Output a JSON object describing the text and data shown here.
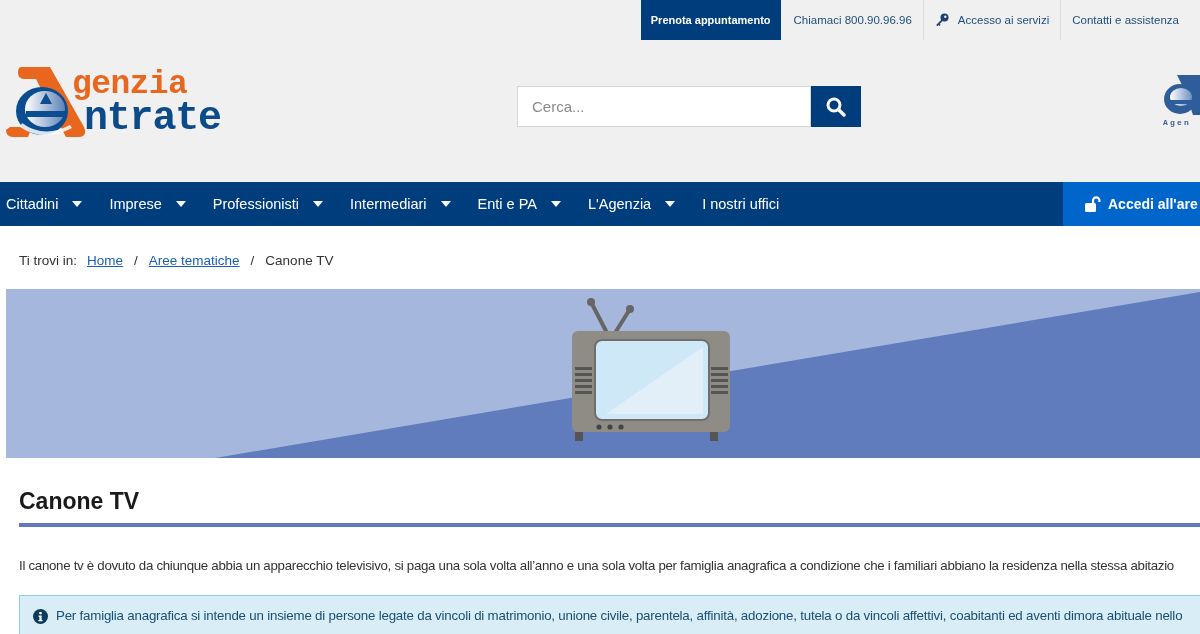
{
  "top_bar": {
    "appointment_button": "Prenota appuntamento",
    "links": [
      {
        "kind": "text",
        "label": "Chiamaci 800.90.96.96"
      },
      {
        "kind": "key",
        "label": "Accesso ai servizi"
      },
      {
        "kind": "text",
        "label": "Contatti e assistenza"
      }
    ]
  },
  "header": {
    "logo": {
      "line_1": "genzia",
      "line_2": "ntrate"
    },
    "search": {
      "placeholder": "Cerca..."
    },
    "emblem_caption": "Agen"
  },
  "nav": {
    "items": [
      {
        "label": "Cittadini",
        "has_menu": true
      },
      {
        "label": "Imprese",
        "has_menu": true
      },
      {
        "label": "Professionisti",
        "has_menu": true
      },
      {
        "label": "Intermediari",
        "has_menu": true
      },
      {
        "label": "Enti e PA",
        "has_menu": true
      },
      {
        "label": "L'Agenzia",
        "has_menu": true
      },
      {
        "label": "I nostri uffici",
        "has_menu": false
      }
    ],
    "login_button": "Accedi all'are"
  },
  "breadcrumb": [
    {
      "kind": "label",
      "text": "Ti trovi in:"
    },
    {
      "kind": "link",
      "text": "Home"
    },
    {
      "kind": "separator",
      "text": "/"
    },
    {
      "kind": "link",
      "text": "Aree tematiche"
    },
    {
      "kind": "separator",
      "text": "/"
    },
    {
      "kind": "current",
      "text": "Canone TV"
    }
  ],
  "content": {
    "title": "Canone TV",
    "intro": "Il canone tv è dovuto da chiunque abbia un apparecchio televisivo, si paga una sola volta all’anno e una sola volta per famiglia anagrafica a condizione che i familiari abbiano la residenza nella stessa abitazio",
    "info_note": "Per famiglia anagrafica si intende un insieme di persone legate da vincoli di matrimonio, unione civile, parentela, affinità, adozione, tutela o da vincoli affettivi, coabitanti ed aventi dimora abituale nello"
  }
}
